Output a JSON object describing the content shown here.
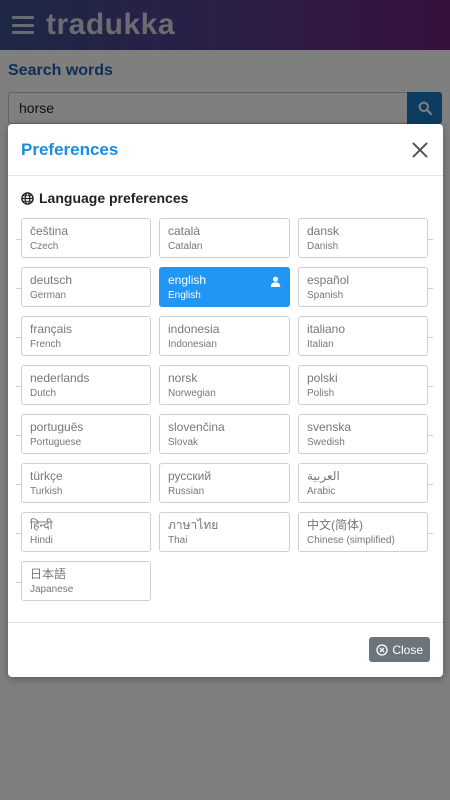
{
  "app": {
    "logo": "tradukka"
  },
  "page": {
    "title": "Search words"
  },
  "search": {
    "value": "horse"
  },
  "modal": {
    "title": "Preferences",
    "section_title": "Language preferences",
    "close_label": "Close",
    "selected_color": "#2196f3",
    "languages": [
      {
        "native": "čeština",
        "english": "Czech",
        "selected": false
      },
      {
        "native": "català",
        "english": "Catalan",
        "selected": false
      },
      {
        "native": "dansk",
        "english": "Danish",
        "selected": false
      },
      {
        "native": "deutsch",
        "english": "German",
        "selected": false
      },
      {
        "native": "english",
        "english": "English",
        "selected": true
      },
      {
        "native": "español",
        "english": "Spanish",
        "selected": false
      },
      {
        "native": "français",
        "english": "French",
        "selected": false
      },
      {
        "native": "indonesia",
        "english": "Indonesian",
        "selected": false
      },
      {
        "native": "italiano",
        "english": "Italian",
        "selected": false
      },
      {
        "native": "nederlands",
        "english": "Dutch",
        "selected": false
      },
      {
        "native": "norsk",
        "english": "Norwegian",
        "selected": false
      },
      {
        "native": "polski",
        "english": "Polish",
        "selected": false
      },
      {
        "native": "português",
        "english": "Portuguese",
        "selected": false
      },
      {
        "native": "slovenčina",
        "english": "Slovak",
        "selected": false
      },
      {
        "native": "svenska",
        "english": "Swedish",
        "selected": false
      },
      {
        "native": "türkçe",
        "english": "Turkish",
        "selected": false
      },
      {
        "native": "русский",
        "english": "Russian",
        "selected": false
      },
      {
        "native": "العربية",
        "english": "Arabic",
        "selected": false
      },
      {
        "native": "हिन्दी",
        "english": "Hindi",
        "selected": false
      },
      {
        "native": "ภาษาไทย",
        "english": "Thai",
        "selected": false
      },
      {
        "native": "中文(简体)",
        "english": "Chinese (simplified)",
        "selected": false
      },
      {
        "native": "日本語",
        "english": "Japanese",
        "selected": false
      }
    ]
  },
  "icons": {
    "menu": "hamburger-icon",
    "search": "search-icon",
    "globe": "globe-icon",
    "close": "close-icon",
    "user": "user-icon",
    "close_circle": "close-circle-icon"
  }
}
